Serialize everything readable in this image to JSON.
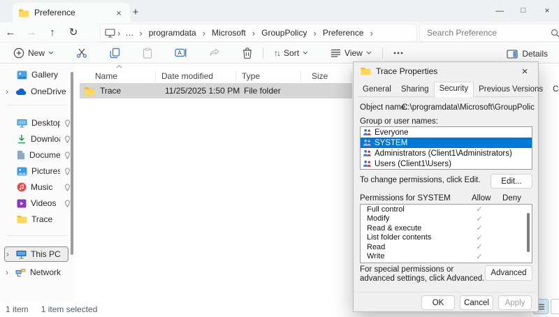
{
  "window": {
    "tab_title": "Preference",
    "status_items": "1 item",
    "status_selected": "1 item selected"
  },
  "address_bar": {
    "overflow": "…",
    "breadcrumbs": [
      "programdata",
      "Microsoft",
      "GroupPolicy",
      "Preference"
    ],
    "search_placeholder": "Search Preference"
  },
  "toolbar": {
    "new_label": "New",
    "sort_label": "Sort",
    "view_label": "View",
    "details_label": "Details"
  },
  "sidebar": {
    "items": [
      {
        "label": "Gallery"
      },
      {
        "label": "OneDrive"
      },
      {
        "label": "Desktop",
        "pinned": true
      },
      {
        "label": "Downloads",
        "pinned": true
      },
      {
        "label": "Documents",
        "pinned": true
      },
      {
        "label": "Pictures",
        "pinned": true
      },
      {
        "label": "Music",
        "pinned": true
      },
      {
        "label": "Videos",
        "pinned": true
      },
      {
        "label": "Trace"
      },
      {
        "label": "This PC"
      },
      {
        "label": "Network"
      }
    ]
  },
  "file_list": {
    "columns": [
      "Name",
      "Date modified",
      "Type",
      "Size"
    ],
    "rows": [
      {
        "name": "Trace",
        "date_modified": "11/25/2025 1:50 PM",
        "type": "File folder",
        "size": ""
      }
    ]
  },
  "dialog": {
    "title": "Trace Properties",
    "tabs": [
      "General",
      "Sharing",
      "Security",
      "Previous Versions",
      "Customize"
    ],
    "active_tab": "Security",
    "object_name_label": "Object name:",
    "object_name": "C:\\programdata\\Microsoft\\GroupPolicy\\Preference\\T",
    "group_list_label": "Group or user names:",
    "groups": [
      "Everyone",
      "SYSTEM",
      "Administrators (Client1\\Administrators)",
      "Users (Client1\\Users)"
    ],
    "selected_group": "SYSTEM",
    "edit_hint": "To change permissions, click Edit.",
    "edit_button_label": "Edit...",
    "permissions_label": "Permissions for SYSTEM",
    "allow_label": "Allow",
    "deny_label": "Deny",
    "check_glyph": "✓",
    "permissions": [
      {
        "name": "Full control",
        "allow": true,
        "deny": false
      },
      {
        "name": "Modify",
        "allow": true,
        "deny": false
      },
      {
        "name": "Read & execute",
        "allow": true,
        "deny": false
      },
      {
        "name": "List folder contents",
        "allow": true,
        "deny": false
      },
      {
        "name": "Read",
        "allow": true,
        "deny": false
      },
      {
        "name": "Write",
        "allow": true,
        "deny": false
      }
    ],
    "advanced_hint": "For special permissions or advanced settings, click Advanced.",
    "advanced_button_label": "Advanced",
    "ok_label": "OK",
    "cancel_label": "Cancel",
    "apply_label": "Apply"
  },
  "colors": {
    "selection_blue": "#0078d7",
    "row_selected_gray": "#d6d6d6",
    "folder_yellow": "#ffb900",
    "accent_blue": "#0067c0"
  }
}
